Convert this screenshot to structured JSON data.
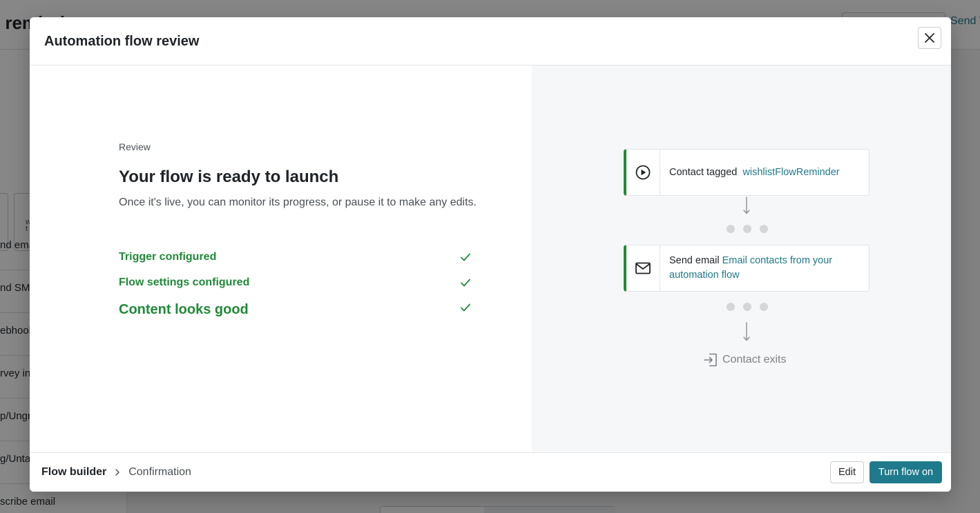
{
  "background": {
    "page_title": "r remind",
    "header_link": "Send T",
    "sidebar_items": [
      "nd ema",
      "nd SMS",
      "ebhook",
      "rvey in",
      "p/Ungro",
      "g/Untag",
      "scribe email"
    ],
    "card_text": "w\nt"
  },
  "modal": {
    "title": "Automation flow review",
    "close_label": "Close",
    "review": {
      "eyebrow": "Review",
      "headline": "Your flow is ready to launch",
      "description": "Once it's live, you can monitor its progress, or pause it to make any edits.",
      "checks": [
        {
          "label": "Trigger configured",
          "status": "complete"
        },
        {
          "label": "Flow settings configured",
          "status": "complete"
        },
        {
          "label": "Content looks good",
          "status": "complete"
        }
      ]
    },
    "flow": {
      "steps": [
        {
          "icon": "play-circle-icon",
          "label": "Contact tagged",
          "detail": "wishlistFlowReminder"
        },
        {
          "icon": "envelope-icon",
          "label": "Send email",
          "detail": "Email contacts from your automation flow"
        }
      ],
      "exit_label": "Contact exits"
    },
    "footer": {
      "breadcrumb": [
        "Flow builder",
        "Confirmation"
      ],
      "edit_label": "Edit",
      "primary_label": "Turn flow on"
    }
  },
  "colors": {
    "accent": "#1f7a8c",
    "success": "#208a38",
    "overlay": "rgba(0,0,0,0.47)"
  }
}
